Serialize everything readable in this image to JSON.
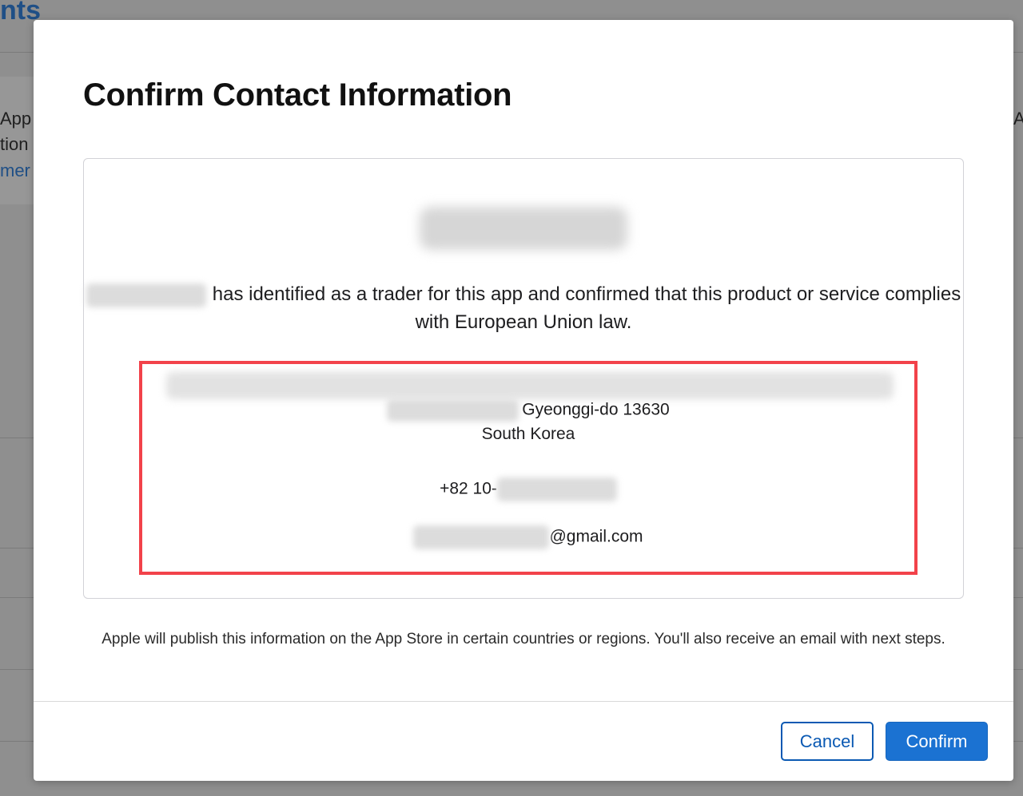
{
  "background": {
    "heading_fragment": "nts",
    "left_line_1": "App",
    "left_line_2": "tion",
    "left_line_3": "mer",
    "right_fragment": "A"
  },
  "dialog": {
    "title": "Confirm Contact Information",
    "trader_statement": "has identified as a trader for this app and confirmed that this product or service complies with European Union law.",
    "address": {
      "region_postal": "Gyeonggi-do 13630",
      "country": "South Korea",
      "phone_prefix": "+82 10-",
      "email_domain": "@gmail.com"
    },
    "footnote": "Apple will publish this information on the App Store in certain countries or regions. You'll also receive an email with next steps.",
    "buttons": {
      "cancel": "Cancel",
      "confirm": "Confirm"
    }
  },
  "colors": {
    "accent": "#1b72d2",
    "highlight_border": "#f2424a",
    "overlay": "#8f8f8f"
  }
}
